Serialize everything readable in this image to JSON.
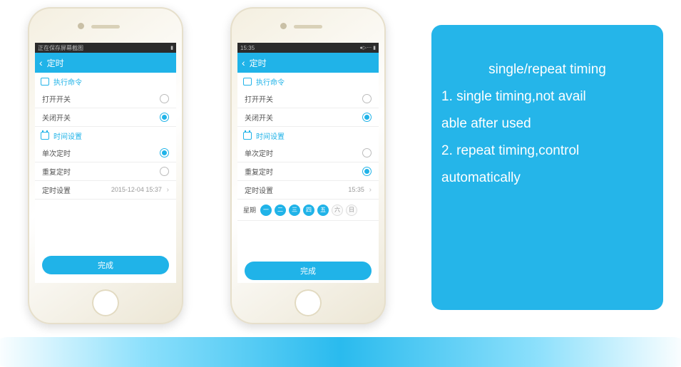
{
  "status": {
    "left1": "正在保存屏幕截图",
    "time2": "15:35",
    "icons2": "●▷⋯"
  },
  "title": "定时",
  "sections": {
    "exec": "执行命令",
    "timeset": "时间设置"
  },
  "rows": {
    "open": "打开开关",
    "close": "关闭开关",
    "single": "单次定时",
    "repeat": "重复定时",
    "timecfg": "定时设置",
    "week": "星期"
  },
  "values": {
    "datetime1": "2015-12-04 15:37",
    "time2": "15:35"
  },
  "days": [
    "一",
    "二",
    "三",
    "四",
    "五",
    "六",
    "日"
  ],
  "done": "完成",
  "info": {
    "title": "single/repeat timing",
    "l1": "1. single timing,not avail",
    "l2": "able after used",
    "l3": "2. repeat timing,control",
    "l4": "automatically"
  }
}
